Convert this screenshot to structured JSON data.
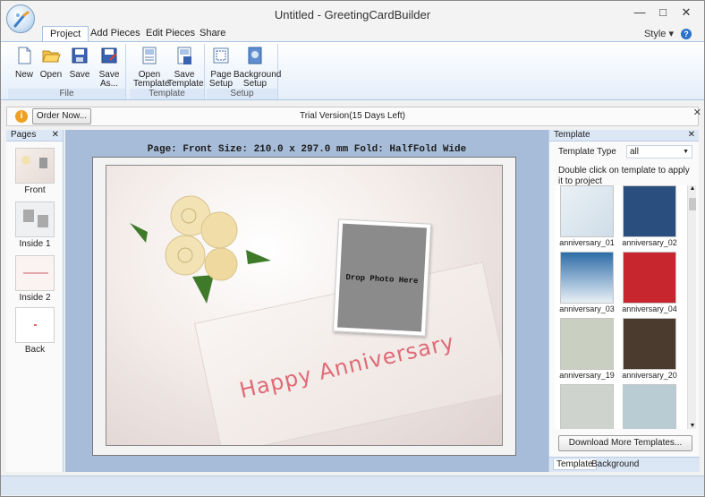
{
  "window": {
    "title": "Untitled - GreetingCardBuilder",
    "minimize": "—",
    "maximize": "□",
    "close": "✕"
  },
  "tabs": [
    "Project",
    "Add Pieces",
    "Edit Pieces",
    "Share"
  ],
  "style_menu": "Style",
  "help": "?",
  "ribbon": {
    "file_group": {
      "label": "File",
      "buttons": [
        "New",
        "Open",
        "Save",
        "Save As..."
      ]
    },
    "template_group": {
      "label": "Template",
      "buttons": [
        "Open Template",
        "Save Template"
      ]
    },
    "setup_group": {
      "label": "Setup",
      "buttons": [
        "Page Setup",
        "Background Setup"
      ]
    }
  },
  "infobar": {
    "info_icon": "i",
    "order_button": "Order Now...",
    "trial_text": "Trial Version(15 Days Left)",
    "close": "✕"
  },
  "pages_panel": {
    "title": "Pages",
    "close": "✕",
    "pages": [
      "Front",
      "Inside 1",
      "Inside 2",
      "Back"
    ]
  },
  "canvas": {
    "page_info": "Page: Front   Size: 210.0 x 297.0 mm   Fold: HalfFold Wide",
    "drop_text": "Drop Photo Here",
    "card_text": "Happy Anniversary"
  },
  "template_panel": {
    "title": "Template",
    "close": "✕",
    "type_label": "Template Type",
    "type_value": "all",
    "hint": "Double click on template to apply it to project",
    "items": [
      "anniversary_01",
      "anniversary_02",
      "anniversary_03",
      "anniversary_04",
      "anniversary_19",
      "anniversary_20"
    ],
    "download_button": "Download More Templates...",
    "bottom_tabs": [
      "Template",
      "Background"
    ]
  },
  "colors": {
    "accent": "#2a72c9",
    "ribbon_border": "#a8c3e3",
    "canvas_bg": "#a7bcd8",
    "card_text": "#e06a76"
  }
}
